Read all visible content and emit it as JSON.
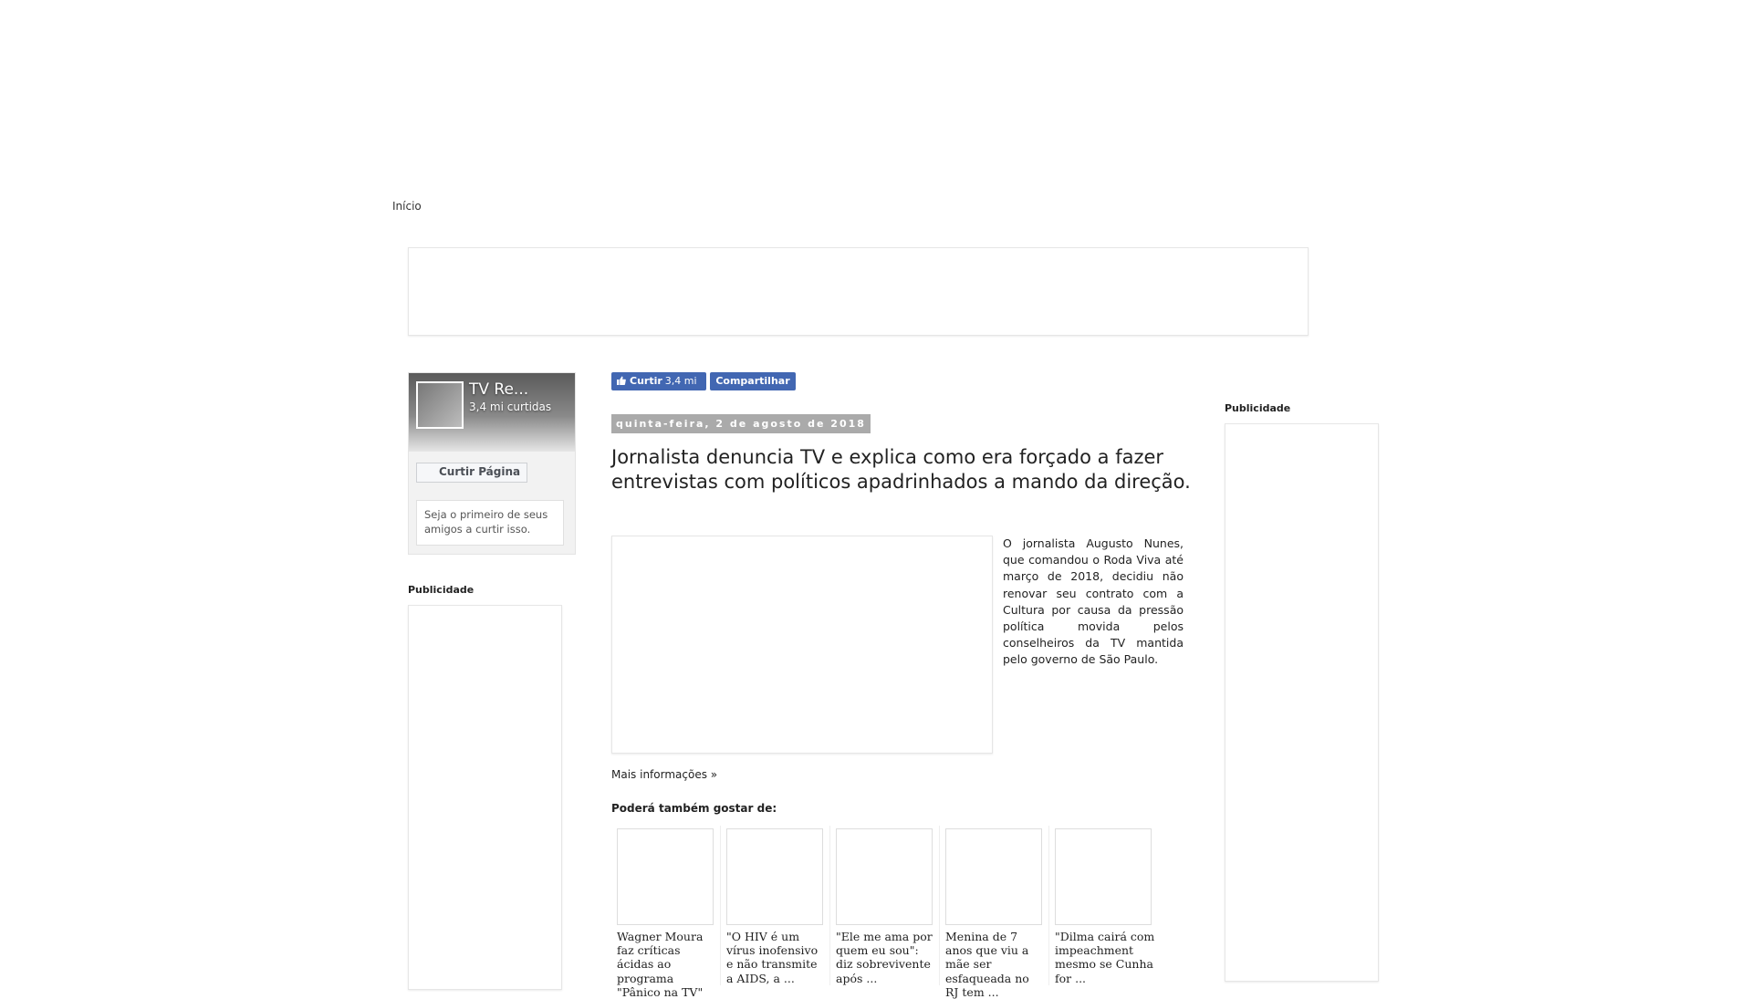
{
  "nav": {
    "home_label": "Início"
  },
  "facebook_widget": {
    "page_name": "TV Re...",
    "likes_count": "3,4 mi curtidas",
    "like_page_button": "Curtir Página",
    "friends_text": "Seja o primeiro de seus amigos a curtir isso."
  },
  "left_sidebar": {
    "ad_label": "Publicidade"
  },
  "right_sidebar": {
    "ad_label": "Publicidade"
  },
  "share_bar": {
    "like_label": "Curtir",
    "like_count": "3,4 mi",
    "share_label": "Compartilhar"
  },
  "post": {
    "date": "quinta-feira, 2 de agosto de 2018",
    "title": "Jornalista denuncia TV e explica como era forçado a fazer entrevistas com políticos apadrinhados a mando da direção.",
    "excerpt": "O jornalista Augusto Nunes, que comandou o Roda Viva até março de 2018, decidiu não renovar seu contrato com a Cultura por causa da pressão política movida pelos conselheiros da TV mantida pelo governo de São Paulo.",
    "more_link": "Mais informações »"
  },
  "related": {
    "heading": "Poderá também gostar de:",
    "items": [
      {
        "title": "Wagner Moura faz críticas ácidas ao programa \"Pânico na TV\""
      },
      {
        "title": "\"O HIV é um vírus inofensivo e não transmite a AIDS, a ..."
      },
      {
        "title": "\"Ele me ama por quem eu sou\": diz sobrevivente após ..."
      },
      {
        "title": "Menina de 7 anos que viu a mãe ser esfaqueada no RJ tem ..."
      },
      {
        "title": "\"Dilma cairá com impeachment mesmo se Cunha for ..."
      }
    ]
  },
  "colors": {
    "facebook_blue": "#4267b2",
    "date_bar": "#aaaaaa"
  }
}
